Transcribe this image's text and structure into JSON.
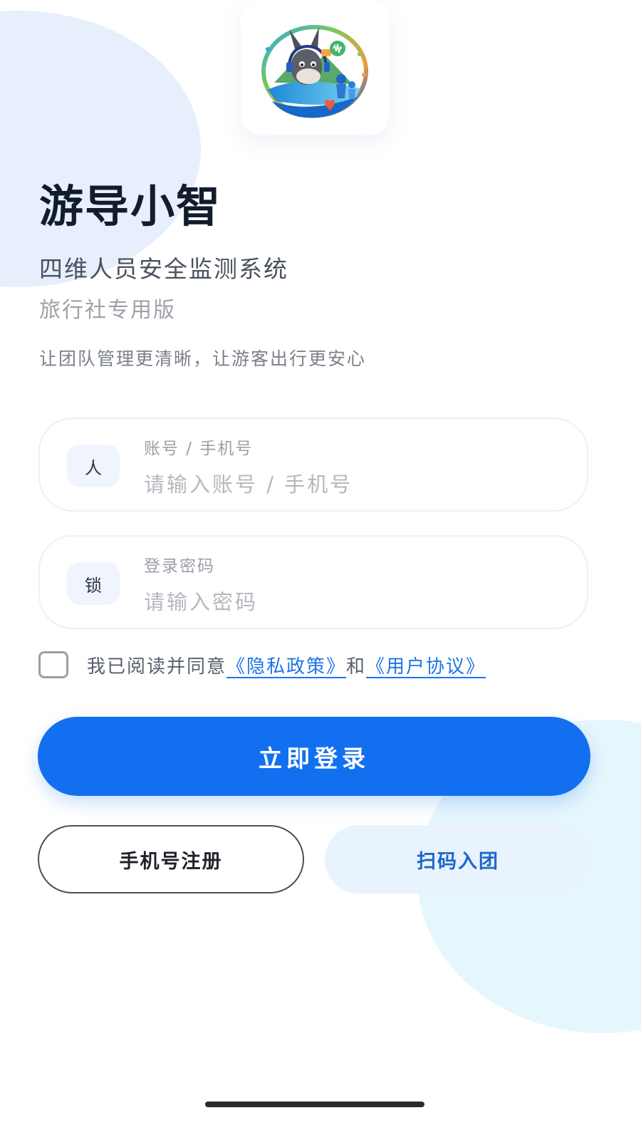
{
  "app": {
    "name": "游导小智",
    "subtitle": "四维人员安全监测系统",
    "edition": "旅行社专用版",
    "slogan": "让团队管理更清晰，让游客出行更安心"
  },
  "login_form": {
    "account": {
      "icon_text": "人",
      "label": "账号 / 手机号",
      "placeholder": "请输入账号 / 手机号",
      "value": ""
    },
    "password": {
      "icon_text": "锁",
      "label": "登录密码",
      "placeholder": "请输入密码",
      "value": ""
    },
    "agreement": {
      "checked": false,
      "prefix": "我已阅读并同意",
      "privacy_link": "《隐私政策》",
      "connector": "和",
      "terms_link": "《用户协议》"
    },
    "login_button": "立即登录"
  },
  "secondary_actions": {
    "register_button": "手机号注册",
    "scan_button": "扫码入团"
  },
  "colors": {
    "primary": "#1270f0",
    "link": "#1d75e8",
    "title": "#121c2c",
    "scan_button_bg": "#e9f3fd"
  },
  "icons": {
    "logo": "donkey-guide-logo"
  }
}
